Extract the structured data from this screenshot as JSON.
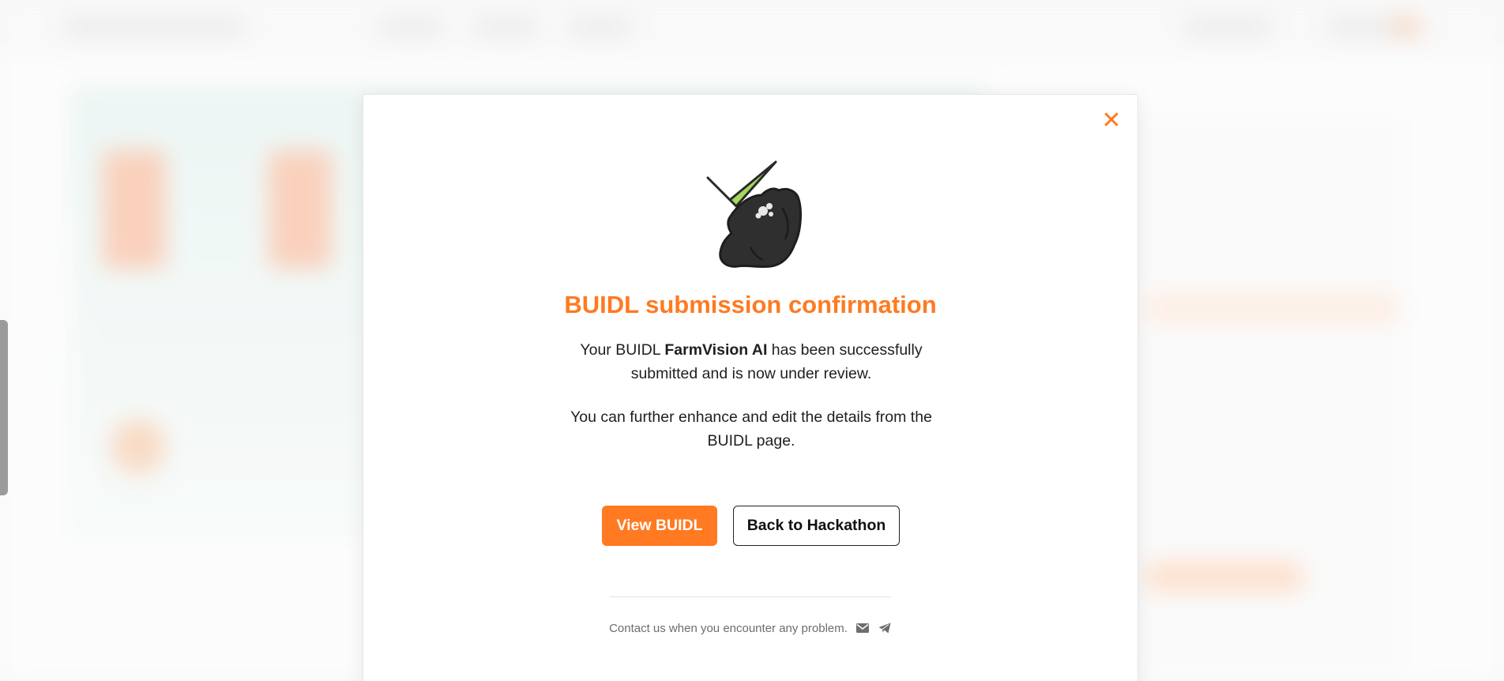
{
  "modal": {
    "title": "BUIDL submission confirmation",
    "message1_before": "Your BUIDL ",
    "project_name": "FarmVision AI",
    "message1_after": " has been successfully submitted and is now under review.",
    "message2": "You can further enhance and edit the details from the BUIDL page.",
    "view_button": "View BUIDL",
    "back_button": "Back to Hackathon",
    "footer_text": "Contact us when you encounter any problem.",
    "close_icon": "close-icon",
    "footer_icons": [
      "mail-icon",
      "telegram-icon"
    ]
  },
  "colors": {
    "accent": "#ff7a21",
    "illustration_check": "#a6d85c",
    "illustration_cat": "#2f2f2f"
  }
}
